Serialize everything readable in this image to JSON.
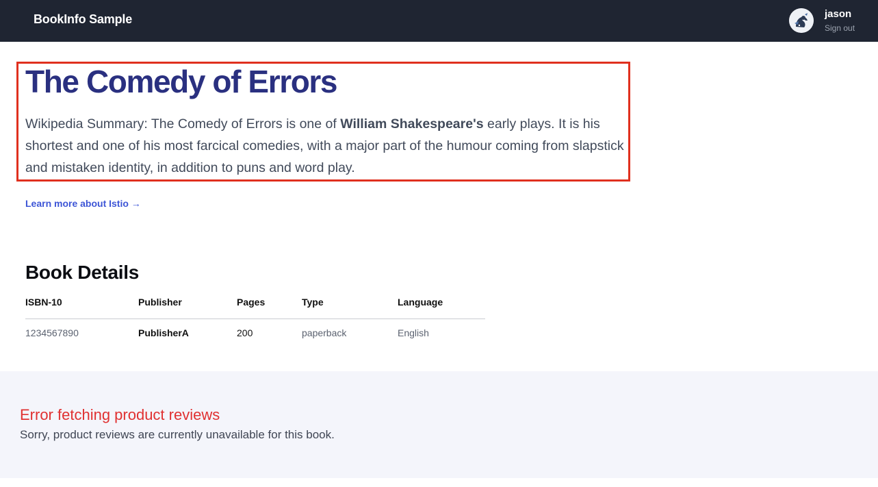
{
  "header": {
    "brand": "BookInfo Sample",
    "user": {
      "name": "jason",
      "sign_out": "Sign out",
      "avatar_icon": "user-avatar-icon"
    }
  },
  "product": {
    "title": "The Comedy of Errors",
    "summary_prefix": "Wikipedia Summary: The Comedy of Errors is one of ",
    "summary_author": "William Shakespeare's",
    "summary_suffix": " early plays. It is his shortest and one of his most farcical comedies, with a major part of the humour coming from slapstick and mistaken identity, in addition to puns and word play.",
    "learn_more": "Learn more about Istio →"
  },
  "details": {
    "title": "Book Details",
    "headers": [
      "ISBN-10",
      "Publisher",
      "Pages",
      "Type",
      "Language"
    ],
    "row": [
      "1234567890",
      "PublisherA",
      "200",
      "paperback",
      "English"
    ]
  },
  "reviews": {
    "error_title": "Error fetching product reviews",
    "error_message": "Sorry, product reviews are currently unavailable for this book."
  },
  "colors": {
    "topbar": "#1f2532",
    "title": "#2a3080",
    "link": "#3d55d6",
    "error": "#e03131",
    "highlight": "#e0301e",
    "reviews_bg": "#f4f5fb"
  }
}
